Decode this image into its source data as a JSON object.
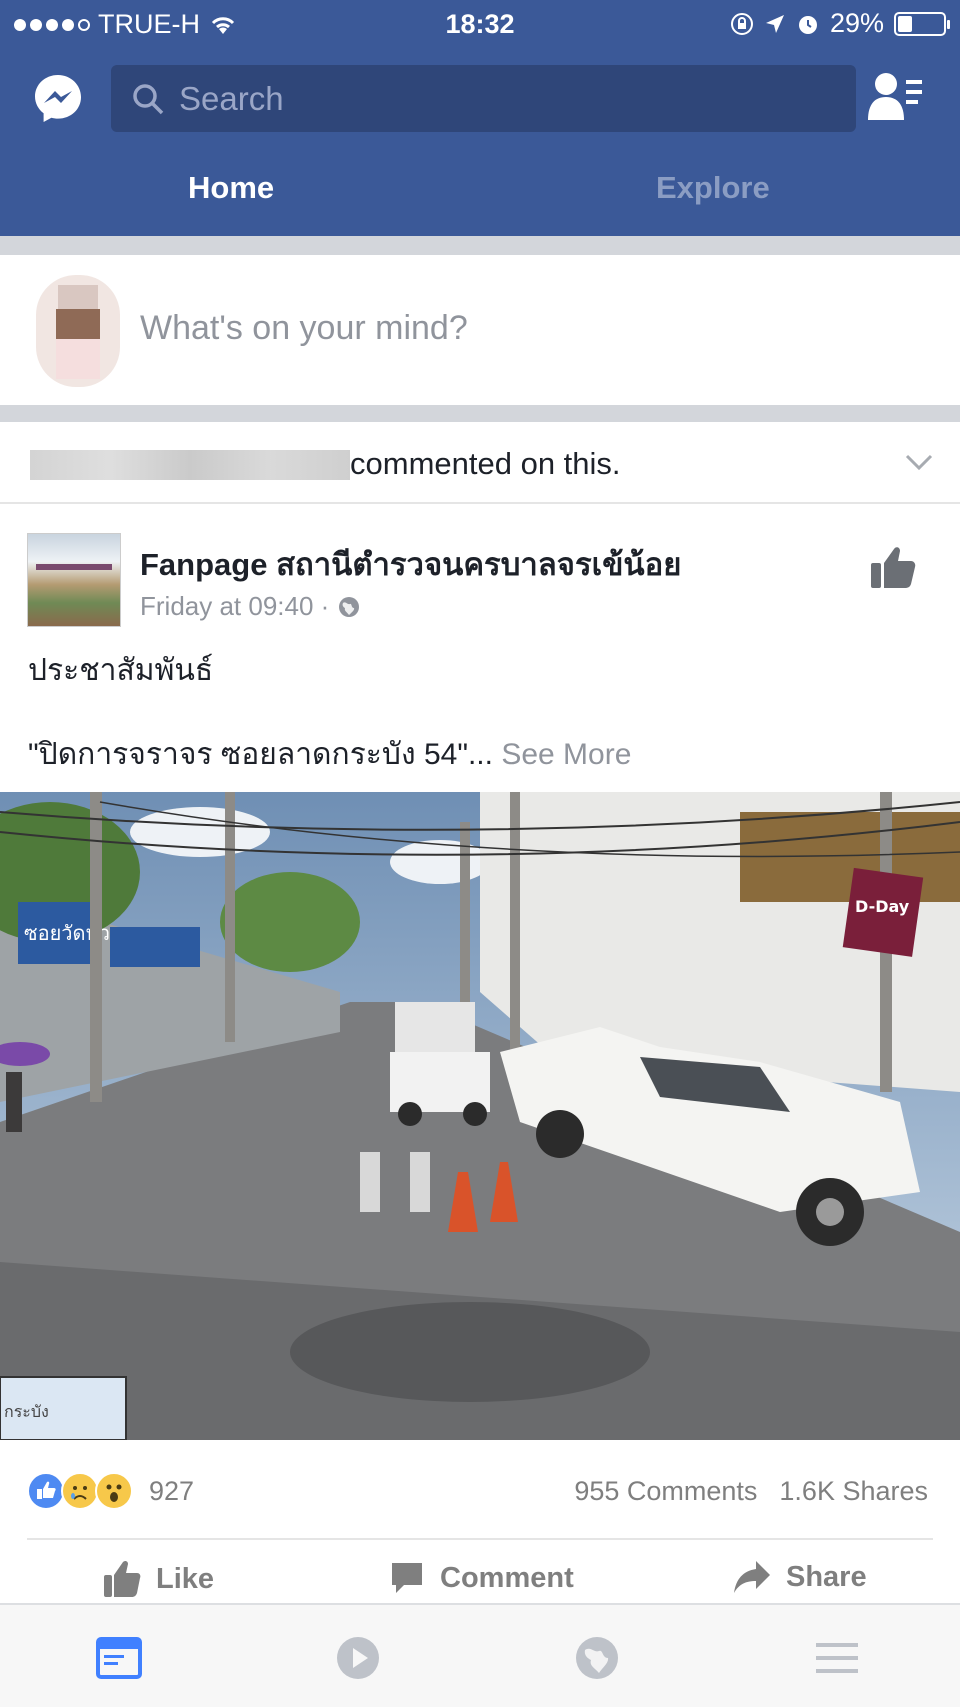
{
  "status_bar": {
    "carrier": "TRUE-H",
    "time": "18:32",
    "battery": "29%"
  },
  "header": {
    "search_placeholder": "Search",
    "tabs": [
      {
        "label": "Home",
        "active": true
      },
      {
        "label": "Explore",
        "active": false
      }
    ]
  },
  "composer": {
    "placeholder": "What's on your mind?"
  },
  "story": {
    "context_text": "commented on this.",
    "page_name": "Fanpage สถานีตำรวจนครบาลจรเข้น้อย",
    "timestamp": "Friday at 09:40 ·",
    "line1": "ประชาสัมพันธ์",
    "line2": "\"ปิดการจราจร ซอยลาดกระบัง 54\"...",
    "see_more": "See More",
    "photo_sign_left": "ซอยวัดหัว",
    "photo_map_label": "กระบัง",
    "photo_shop_sign": "D-Day",
    "reaction_count": "927",
    "comments": "955 Comments",
    "shares": "1.6K Shares"
  },
  "actions": {
    "like": "Like",
    "comment": "Comment",
    "share": "Share"
  },
  "colors": {
    "brand": "#3b5998",
    "search_bg": "#2f4679",
    "muted": "#90949c"
  },
  "icons": [
    "messenger-icon",
    "search-icon",
    "friend-requests-icon",
    "chevron-down-icon",
    "like-icon",
    "globe-icon",
    "comment-icon",
    "share-icon",
    "news-feed-icon",
    "video-icon",
    "notifications-globe-icon",
    "menu-icon"
  ]
}
